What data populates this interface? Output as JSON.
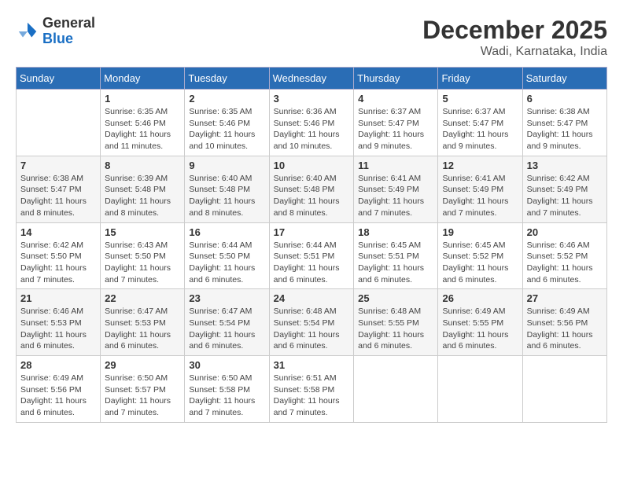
{
  "header": {
    "logo": {
      "general": "General",
      "blue": "Blue"
    },
    "title": "December 2025",
    "subtitle": "Wadi, Karnataka, India"
  },
  "calendar": {
    "days_of_week": [
      "Sunday",
      "Monday",
      "Tuesday",
      "Wednesday",
      "Thursday",
      "Friday",
      "Saturday"
    ],
    "weeks": [
      [
        {
          "day": "",
          "sunrise": "",
          "sunset": "",
          "daylight": ""
        },
        {
          "day": "1",
          "sunrise": "Sunrise: 6:35 AM",
          "sunset": "Sunset: 5:46 PM",
          "daylight": "Daylight: 11 hours and 11 minutes."
        },
        {
          "day": "2",
          "sunrise": "Sunrise: 6:35 AM",
          "sunset": "Sunset: 5:46 PM",
          "daylight": "Daylight: 11 hours and 10 minutes."
        },
        {
          "day": "3",
          "sunrise": "Sunrise: 6:36 AM",
          "sunset": "Sunset: 5:46 PM",
          "daylight": "Daylight: 11 hours and 10 minutes."
        },
        {
          "day": "4",
          "sunrise": "Sunrise: 6:37 AM",
          "sunset": "Sunset: 5:47 PM",
          "daylight": "Daylight: 11 hours and 9 minutes."
        },
        {
          "day": "5",
          "sunrise": "Sunrise: 6:37 AM",
          "sunset": "Sunset: 5:47 PM",
          "daylight": "Daylight: 11 hours and 9 minutes."
        },
        {
          "day": "6",
          "sunrise": "Sunrise: 6:38 AM",
          "sunset": "Sunset: 5:47 PM",
          "daylight": "Daylight: 11 hours and 9 minutes."
        }
      ],
      [
        {
          "day": "7",
          "sunrise": "Sunrise: 6:38 AM",
          "sunset": "Sunset: 5:47 PM",
          "daylight": "Daylight: 11 hours and 8 minutes."
        },
        {
          "day": "8",
          "sunrise": "Sunrise: 6:39 AM",
          "sunset": "Sunset: 5:48 PM",
          "daylight": "Daylight: 11 hours and 8 minutes."
        },
        {
          "day": "9",
          "sunrise": "Sunrise: 6:40 AM",
          "sunset": "Sunset: 5:48 PM",
          "daylight": "Daylight: 11 hours and 8 minutes."
        },
        {
          "day": "10",
          "sunrise": "Sunrise: 6:40 AM",
          "sunset": "Sunset: 5:48 PM",
          "daylight": "Daylight: 11 hours and 8 minutes."
        },
        {
          "day": "11",
          "sunrise": "Sunrise: 6:41 AM",
          "sunset": "Sunset: 5:49 PM",
          "daylight": "Daylight: 11 hours and 7 minutes."
        },
        {
          "day": "12",
          "sunrise": "Sunrise: 6:41 AM",
          "sunset": "Sunset: 5:49 PM",
          "daylight": "Daylight: 11 hours and 7 minutes."
        },
        {
          "day": "13",
          "sunrise": "Sunrise: 6:42 AM",
          "sunset": "Sunset: 5:49 PM",
          "daylight": "Daylight: 11 hours and 7 minutes."
        }
      ],
      [
        {
          "day": "14",
          "sunrise": "Sunrise: 6:42 AM",
          "sunset": "Sunset: 5:50 PM",
          "daylight": "Daylight: 11 hours and 7 minutes."
        },
        {
          "day": "15",
          "sunrise": "Sunrise: 6:43 AM",
          "sunset": "Sunset: 5:50 PM",
          "daylight": "Daylight: 11 hours and 7 minutes."
        },
        {
          "day": "16",
          "sunrise": "Sunrise: 6:44 AM",
          "sunset": "Sunset: 5:50 PM",
          "daylight": "Daylight: 11 hours and 6 minutes."
        },
        {
          "day": "17",
          "sunrise": "Sunrise: 6:44 AM",
          "sunset": "Sunset: 5:51 PM",
          "daylight": "Daylight: 11 hours and 6 minutes."
        },
        {
          "day": "18",
          "sunrise": "Sunrise: 6:45 AM",
          "sunset": "Sunset: 5:51 PM",
          "daylight": "Daylight: 11 hours and 6 minutes."
        },
        {
          "day": "19",
          "sunrise": "Sunrise: 6:45 AM",
          "sunset": "Sunset: 5:52 PM",
          "daylight": "Daylight: 11 hours and 6 minutes."
        },
        {
          "day": "20",
          "sunrise": "Sunrise: 6:46 AM",
          "sunset": "Sunset: 5:52 PM",
          "daylight": "Daylight: 11 hours and 6 minutes."
        }
      ],
      [
        {
          "day": "21",
          "sunrise": "Sunrise: 6:46 AM",
          "sunset": "Sunset: 5:53 PM",
          "daylight": "Daylight: 11 hours and 6 minutes."
        },
        {
          "day": "22",
          "sunrise": "Sunrise: 6:47 AM",
          "sunset": "Sunset: 5:53 PM",
          "daylight": "Daylight: 11 hours and 6 minutes."
        },
        {
          "day": "23",
          "sunrise": "Sunrise: 6:47 AM",
          "sunset": "Sunset: 5:54 PM",
          "daylight": "Daylight: 11 hours and 6 minutes."
        },
        {
          "day": "24",
          "sunrise": "Sunrise: 6:48 AM",
          "sunset": "Sunset: 5:54 PM",
          "daylight": "Daylight: 11 hours and 6 minutes."
        },
        {
          "day": "25",
          "sunrise": "Sunrise: 6:48 AM",
          "sunset": "Sunset: 5:55 PM",
          "daylight": "Daylight: 11 hours and 6 minutes."
        },
        {
          "day": "26",
          "sunrise": "Sunrise: 6:49 AM",
          "sunset": "Sunset: 5:55 PM",
          "daylight": "Daylight: 11 hours and 6 minutes."
        },
        {
          "day": "27",
          "sunrise": "Sunrise: 6:49 AM",
          "sunset": "Sunset: 5:56 PM",
          "daylight": "Daylight: 11 hours and 6 minutes."
        }
      ],
      [
        {
          "day": "28",
          "sunrise": "Sunrise: 6:49 AM",
          "sunset": "Sunset: 5:56 PM",
          "daylight": "Daylight: 11 hours and 6 minutes."
        },
        {
          "day": "29",
          "sunrise": "Sunrise: 6:50 AM",
          "sunset": "Sunset: 5:57 PM",
          "daylight": "Daylight: 11 hours and 7 minutes."
        },
        {
          "day": "30",
          "sunrise": "Sunrise: 6:50 AM",
          "sunset": "Sunset: 5:58 PM",
          "daylight": "Daylight: 11 hours and 7 minutes."
        },
        {
          "day": "31",
          "sunrise": "Sunrise: 6:51 AM",
          "sunset": "Sunset: 5:58 PM",
          "daylight": "Daylight: 11 hours and 7 minutes."
        },
        {
          "day": "",
          "sunrise": "",
          "sunset": "",
          "daylight": ""
        },
        {
          "day": "",
          "sunrise": "",
          "sunset": "",
          "daylight": ""
        },
        {
          "day": "",
          "sunrise": "",
          "sunset": "",
          "daylight": ""
        }
      ]
    ]
  }
}
